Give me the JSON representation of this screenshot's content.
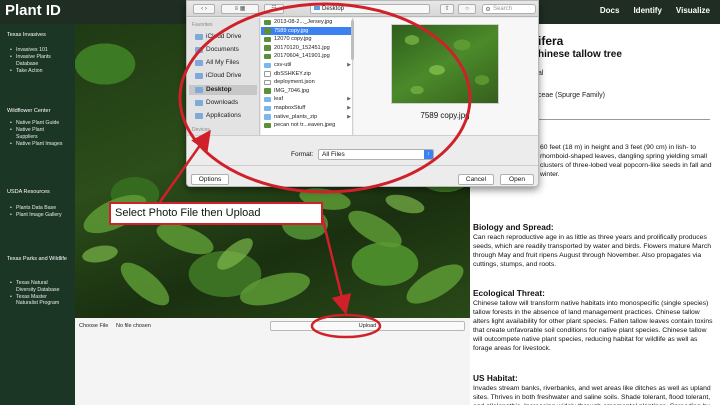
{
  "app": {
    "title": "Plant ID",
    "nav": [
      "Docs",
      "Identify",
      "Visualize"
    ]
  },
  "sidebar": {
    "sections": [
      {
        "heading": "Texas Invasives",
        "items": [
          "Invasives 101",
          "Invasive Plants Database",
          "Take Action"
        ]
      },
      {
        "heading": "Wildflower Center",
        "items": [
          "Native Plant Guide",
          "Native Plant Suppliers",
          "Native Plant Images"
        ]
      },
      {
        "heading": "USDA Resources",
        "items": [
          "Plants Data Base",
          "Plant Image Gallery"
        ]
      },
      {
        "heading": "Texas Parks and Wildlife",
        "items": [
          "Texas Natural Diversity Database",
          "Texas Master Naturalist Program"
        ]
      }
    ]
  },
  "upload": {
    "choose_label": "Choose File",
    "status": "No file chosen",
    "button_label": "Upload"
  },
  "callout": {
    "text": "Select Photo File then Upload"
  },
  "dialog": {
    "location": "Desktop",
    "search_placeholder": "Search",
    "sidebar_heading": "Favorites",
    "devices_heading": "Devices",
    "sidebar_items": [
      "iCloud Drive",
      "Documents",
      "All My Files",
      "iCloud Drive",
      "Desktop",
      "Downloads",
      "Applications"
    ],
    "selected_sidebar": "Desktop",
    "files": [
      {
        "name": "2013-08-2..._Jersey.jpg",
        "kind": "image",
        "folder": false
      },
      {
        "name": "7589 copy.jpg",
        "kind": "image",
        "folder": false,
        "selected": true
      },
      {
        "name": "12070 copy.jpg",
        "kind": "image",
        "folder": false
      },
      {
        "name": "20170120_152451.jpg",
        "kind": "image",
        "folder": false
      },
      {
        "name": "20170604_141901.jpg",
        "kind": "image",
        "folder": false
      },
      {
        "name": "csv-util",
        "kind": "folder",
        "folder": true
      },
      {
        "name": "dbSSHKEY.zip",
        "kind": "doc",
        "folder": false
      },
      {
        "name": "deployment.json",
        "kind": "doc",
        "folder": false
      },
      {
        "name": "IMG_7046.jpg",
        "kind": "image",
        "folder": false
      },
      {
        "name": "leaf",
        "kind": "folder",
        "folder": true
      },
      {
        "name": "mapboxStuff",
        "kind": "folder",
        "folder": true
      },
      {
        "name": "native_plants_zip",
        "kind": "folder",
        "folder": true
      },
      {
        "name": "pecan not tr...eaven.jpeg",
        "kind": "image",
        "folder": false
      }
    ],
    "preview_name": "7589 copy.jpg",
    "format_label": "Format:",
    "format_value": "All Files",
    "options_label": "Options",
    "cancel_label": "Cancel",
    "open_label": "Open"
  },
  "plant": {
    "scientific_name": "ifera",
    "common_name": "hinese tallow tree",
    "line_a": "al",
    "family": "ceae (Spurge Family)",
    "description": "60 feet (18 m) in height and 3 feet (90 cm) in lish- to rhomboid-shaped leaves, dangling spring yielding small clusters of three-lobed veal popcorn-like seeds in fall and winter.",
    "sections": [
      {
        "title": "Biology and Spread:",
        "text": "Can reach reproductive age in as little as three years and prolifically produces seeds, which are readily transported by water and birds. Flowers mature March through May and fruit ripens August through November. Also propagates via cuttings, stumps, and roots."
      },
      {
        "title": "Ecological Threat:",
        "text": "Chinese tallow will transform native habitats into monospecific (single species) tallow forests in the absence of land management practices. Chinese tallow alters light availability for other plant species. Fallen tallow leaves contain toxins that create unfavorable soil conditions for native plant species. Chinese tallow will outcompete native plant species, reducing habitat for wildlife as well as forage areas for livestock."
      },
      {
        "title": "US Habitat:",
        "text": "Invades stream banks, riverbanks, and wet areas like ditches as well as upland sites. Thrives in both freshwater and saline soils. Shade tolerant, flood tolerant, and allelopathic. Increasing widely through ornamental plantings. Spreading by birds and water dispersed seeds and spreading by prolific surface root"
      }
    ]
  },
  "colors": {
    "topbar": "#1f2d22",
    "sidebar": "#1c3626",
    "annotation": "#d0202a",
    "selection": "#3b82f0"
  }
}
